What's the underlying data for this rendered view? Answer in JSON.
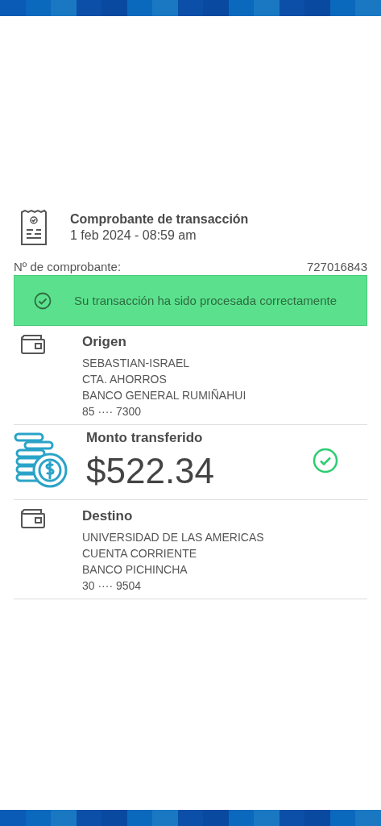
{
  "header": {
    "title": "Comprobante de transacción",
    "date": "1 feb 2024 - 08:59 am"
  },
  "receipt": {
    "label": "Nº de comprobante:",
    "number": "727016843"
  },
  "status": {
    "message": "Su transacción ha sido procesada correctamente"
  },
  "sections": [
    {
      "kind": "account",
      "title": "Origen",
      "lines": [
        "SEBASTIAN-ISRAEL",
        "CTA. AHORROS",
        "BANCO GENERAL RUMIÑAHUI",
        "85 ···· 7300"
      ]
    },
    {
      "kind": "amount",
      "title": "Monto transferido",
      "amount": "$522.34"
    },
    {
      "kind": "account",
      "title": "Destino",
      "lines": [
        "UNIVERSIDAD DE LAS AMERICAS",
        "CUENTA CORRIENTE",
        "BANCO PICHINCHA",
        "30 ···· 9504"
      ]
    }
  ]
}
